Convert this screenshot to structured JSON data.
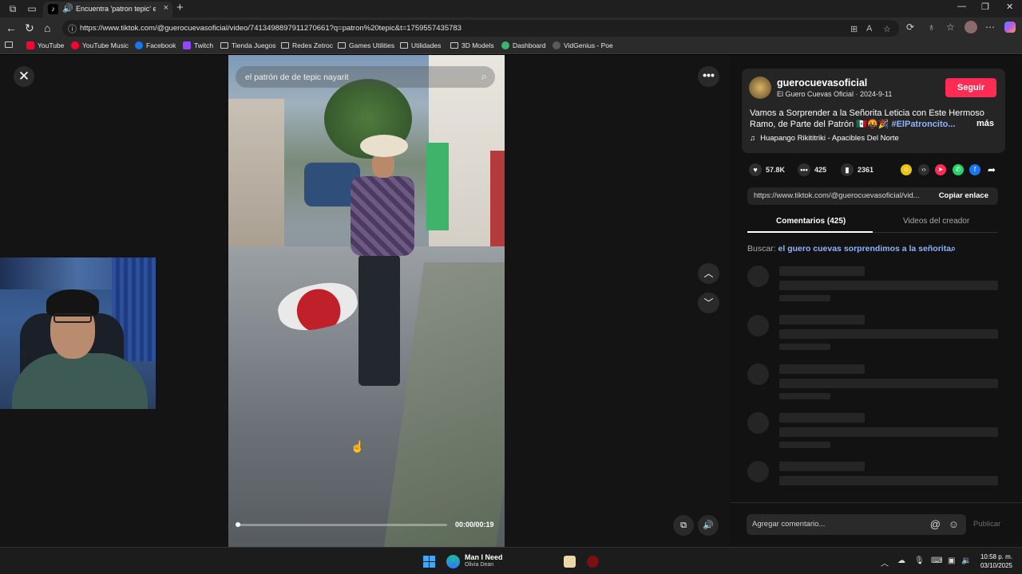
{
  "browser": {
    "tab_title": "Encuentra 'patron tepic' en",
    "tab_close": "×",
    "new_tab": "+",
    "url": "https://www.tiktok.com/@guerocuevasoficial/video/7413498897911270661?q=patron%20tepic&t=1759557435783",
    "bookmarks": [
      "YouTube",
      "YouTube Music",
      "Facebook",
      "Twitch",
      "Tienda Juegos",
      "Redes Zetroc",
      "Games Utilities",
      "Utilidades",
      "3D Models",
      "Dashboard",
      "VidGenius - Poe"
    ],
    "colors": {
      "youtube": "#ff0033",
      "facebook": "#1877f2",
      "twitch": "#9146ff",
      "dashboard": "#3cb371",
      "poe": "#5a5a5a"
    }
  },
  "video": {
    "search_text": "el patrón de de tepic nayarit",
    "time": "00:00/00:19",
    "progress": 0
  },
  "panel": {
    "username": "guerocuevasoficial",
    "nickname_date": "El Guero Cuevas Oficial · 2024-9-11",
    "follow_label": "Seguir",
    "description": "Vamos a Sorprender a la Señorita Leticia con Este Hermoso Ramo, de Parte del Patrón",
    "description_emoji": "🇲🇽🤬🎉",
    "hashtag": "#ElPatroncito...",
    "more_label": "más",
    "music": "Huapango Rikititriki - Apacibles Del Norte",
    "likes": "57.8K",
    "comments": "425",
    "saves": "2361",
    "share_link": "https://www.tiktok.com/@guerocuevasoficial/vid...",
    "copy_label": "Copiar enlace",
    "tab_comments": "Comentarios (425)",
    "tab_videos": "Videos del creador",
    "search_prefix": "Buscar:",
    "search_query": "el guero cuevas sorprendimos a la señorita",
    "comment_placeholder": "Agregar comentario...",
    "publish_label": "Publicar",
    "accent": "#fe2c55"
  },
  "taskbar": {
    "media_title": "Man I Need",
    "media_artist": "Olivia Dean",
    "time": "10:58 p. m.",
    "date": "03/10/2025"
  }
}
